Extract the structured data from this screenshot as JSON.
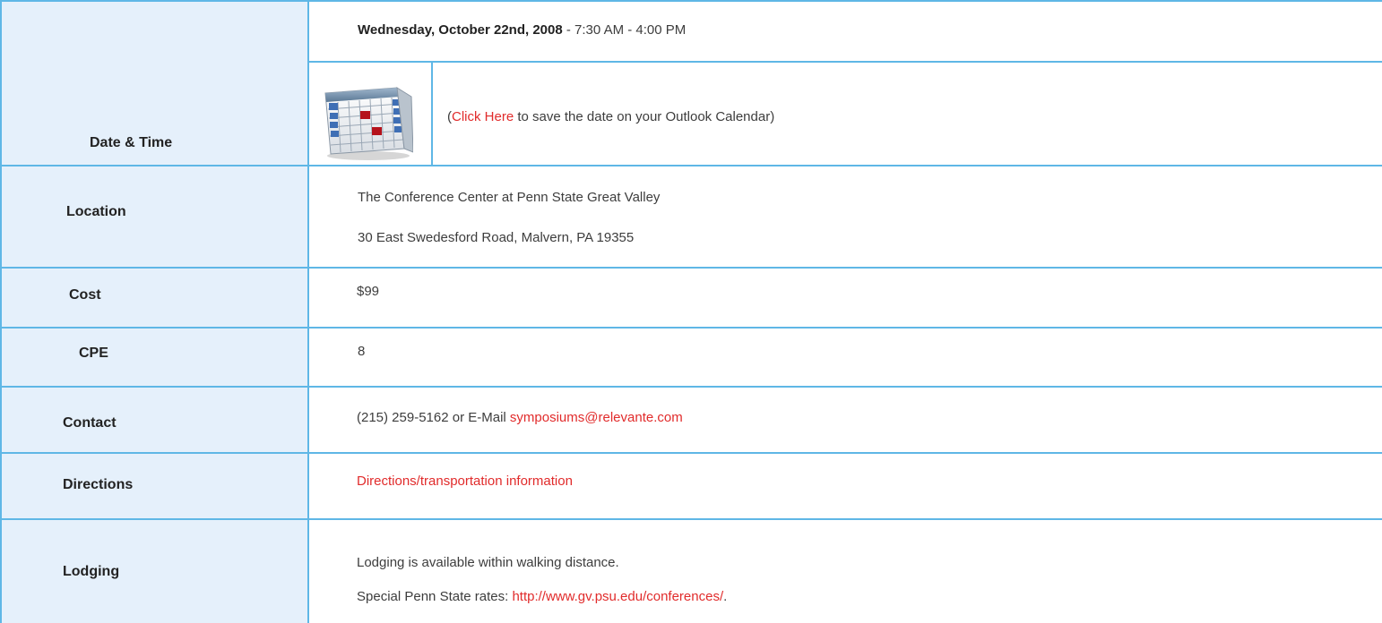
{
  "rows": {
    "date_time": {
      "label": "Date & Time",
      "date_bold": "Wednesday, October 22nd, 2008",
      "time_rest": " - 7:30 AM - 4:00 PM",
      "calendar_open": "(",
      "calendar_link": "Click Here",
      "calendar_rest": " to save the date on your Outlook Calendar)",
      "calendar_icon": "calendar-icon"
    },
    "location": {
      "label": "Location",
      "line1": "The Conference Center at Penn State Great Valley",
      "line2": "30 East Swedesford Road, Malvern, PA 19355"
    },
    "cost": {
      "label": "Cost",
      "value": "$99"
    },
    "cpe": {
      "label": "CPE",
      "value": "8"
    },
    "contact": {
      "label": "Contact",
      "text": "(215) 259-5162 or E-Mail ",
      "email": "symposiums@relevante.com"
    },
    "directions": {
      "label": "Directions",
      "link": "Directions/transportation information"
    },
    "lodging": {
      "label": "Lodging",
      "line1": "Lodging is available within walking distance.",
      "line2_prefix": "Special Penn State rates: ",
      "line2_link": "http://www.gv.psu.edu/conferences/",
      "line2_suffix": "."
    }
  },
  "colors": {
    "border": "#5fb7e6",
    "label_bg": "#e5f0fb",
    "link": "#e12b2b"
  }
}
